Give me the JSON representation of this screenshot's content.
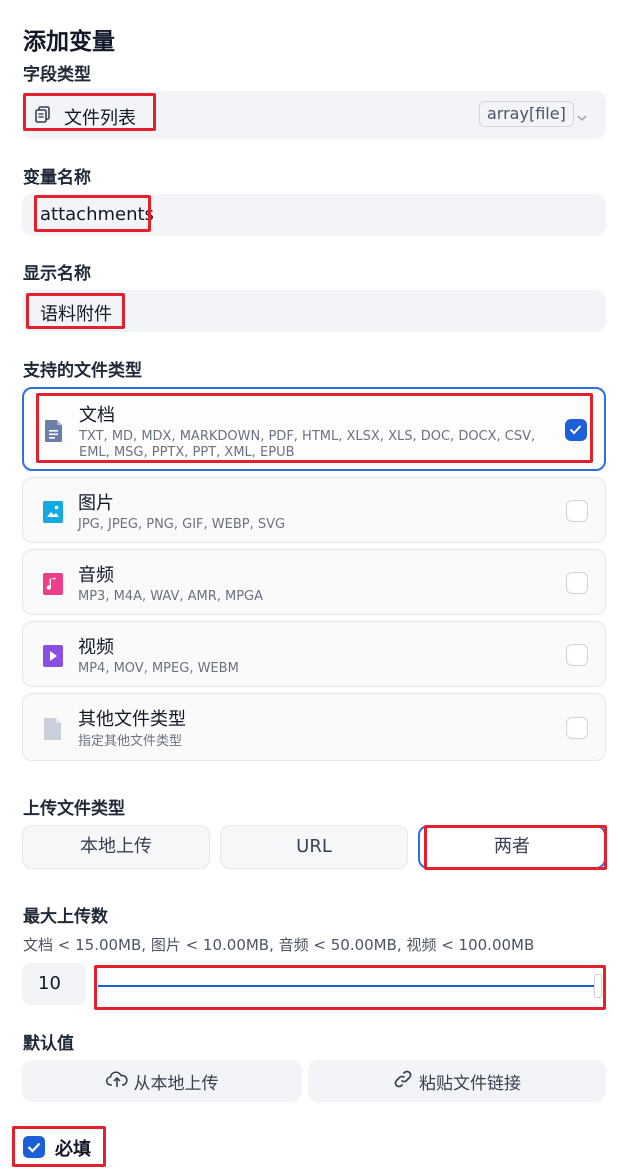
{
  "page": {
    "title": "添加变量"
  },
  "field_type": {
    "label": "字段类型",
    "value": "文件列表",
    "type_chip": "array[file]",
    "icon": "copy-icon"
  },
  "var_name": {
    "label": "变量名称",
    "value": "attachments"
  },
  "display_name": {
    "label": "显示名称",
    "value": "语料附件"
  },
  "file_types": {
    "label": "支持的文件类型",
    "items": [
      {
        "name": "文档",
        "desc": "TXT, MD, MDX, MARKDOWN, PDF, HTML, XLSX, XLS, DOC, DOCX, CSV, EML, MSG, PPTX, PPT, XML, EPUB",
        "checked": true,
        "icon": "document-icon",
        "color": "#6b7ea8"
      },
      {
        "name": "图片",
        "desc": "JPG, JPEG, PNG, GIF, WEBP, SVG",
        "checked": false,
        "icon": "image-icon",
        "color": "#14a9e0"
      },
      {
        "name": "音频",
        "desc": "MP3, M4A, WAV, AMR, MPGA",
        "checked": false,
        "icon": "audio-icon",
        "color": "#ee3f8a"
      },
      {
        "name": "视频",
        "desc": "MP4, MOV, MPEG, WEBM",
        "checked": false,
        "icon": "video-icon",
        "color": "#8a4fe0"
      },
      {
        "name": "其他文件类型",
        "desc": "指定其他文件类型",
        "checked": false,
        "icon": "file-icon",
        "color": "#c9cfdc"
      }
    ]
  },
  "upload_type": {
    "label": "上传文件类型",
    "options": [
      "本地上传",
      "URL",
      "两者"
    ],
    "selected": "两者"
  },
  "max_upload": {
    "label": "最大上传数",
    "limits": "文档 < 15.00MB, 图片 < 10.00MB, 音频 < 50.00MB, 视频 < 100.00MB",
    "value": "10",
    "slider_level": 1.0
  },
  "default_value": {
    "label": "默认值",
    "local_upload": "从本地上传",
    "paste_link": "粘贴文件链接"
  },
  "required": {
    "label": "必填",
    "checked": true
  },
  "colors": {
    "accent": "#1d5fd8",
    "highlight": "#e3202d",
    "field_bg": "#f2f4f7"
  }
}
